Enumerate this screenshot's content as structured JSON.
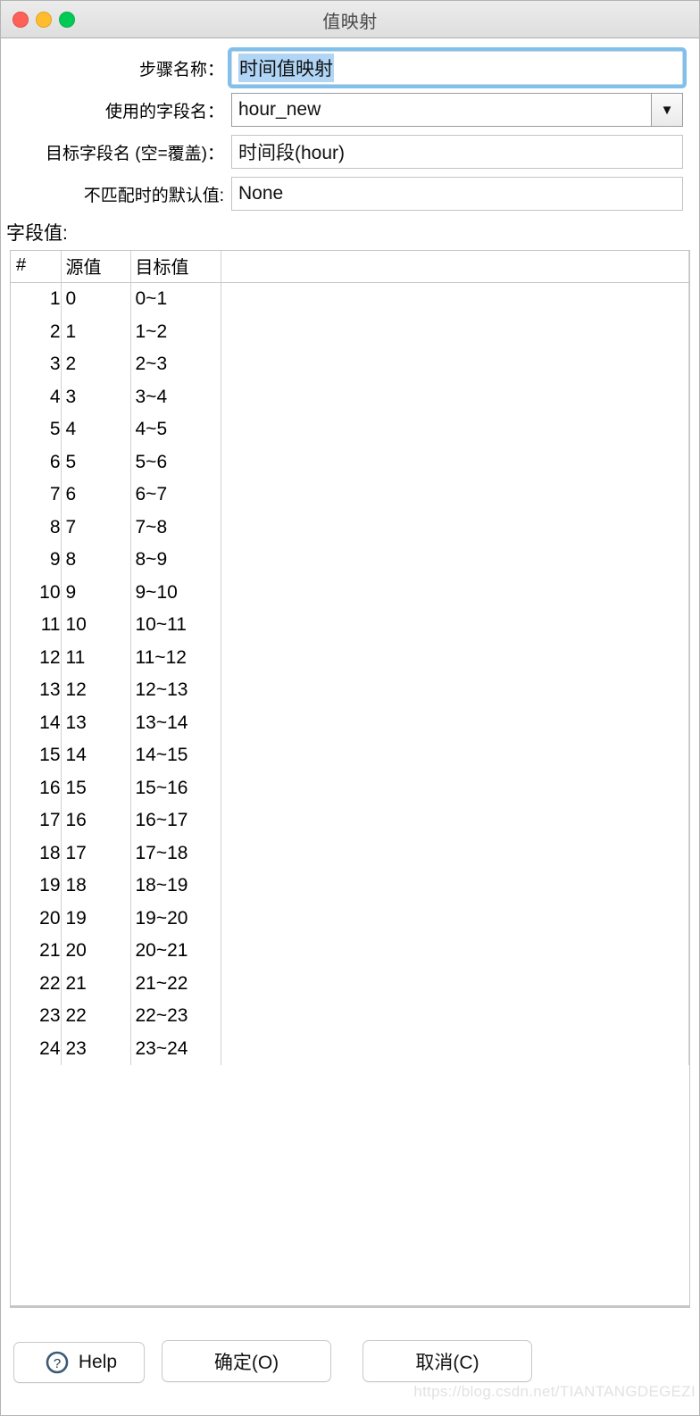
{
  "window": {
    "title": "值映射",
    "traffic_lights": [
      {
        "name": "close",
        "color": "#ff6159"
      },
      {
        "name": "minimize",
        "color": "#ffbd2e"
      },
      {
        "name": "maximize",
        "color": "#00ca56"
      }
    ]
  },
  "form": {
    "step_name": {
      "label": "步骤名称：",
      "value": "时间值映射",
      "selected": true
    },
    "source_field": {
      "label": "使用的字段名：",
      "value": "hour_new",
      "arrow": "▼"
    },
    "target_field": {
      "label": "目标字段名 (空=覆盖)：",
      "value": "时间段(hour)"
    },
    "default_value": {
      "label": "不匹配时的默认值:",
      "value": "None"
    }
  },
  "table": {
    "section_label": "字段值:",
    "columns": [
      "#",
      "源值",
      "目标值",
      ""
    ],
    "rows": [
      {
        "n": "1",
        "src": "0",
        "tgt": "0~1"
      },
      {
        "n": "2",
        "src": "1",
        "tgt": "1~2"
      },
      {
        "n": "3",
        "src": "2",
        "tgt": "2~3"
      },
      {
        "n": "4",
        "src": "3",
        "tgt": "3~4"
      },
      {
        "n": "5",
        "src": "4",
        "tgt": "4~5"
      },
      {
        "n": "6",
        "src": "5",
        "tgt": "5~6"
      },
      {
        "n": "7",
        "src": "6",
        "tgt": "6~7"
      },
      {
        "n": "8",
        "src": "7",
        "tgt": "7~8"
      },
      {
        "n": "9",
        "src": "8",
        "tgt": "8~9"
      },
      {
        "n": "10",
        "src": "9",
        "tgt": "9~10"
      },
      {
        "n": "11",
        "src": "10",
        "tgt": "10~11"
      },
      {
        "n": "12",
        "src": "11",
        "tgt": "11~12"
      },
      {
        "n": "13",
        "src": "12",
        "tgt": "12~13"
      },
      {
        "n": "14",
        "src": "13",
        "tgt": "13~14"
      },
      {
        "n": "15",
        "src": "14",
        "tgt": "14~15"
      },
      {
        "n": "16",
        "src": "15",
        "tgt": "15~16"
      },
      {
        "n": "17",
        "src": "16",
        "tgt": "16~17"
      },
      {
        "n": "18",
        "src": "17",
        "tgt": "17~18"
      },
      {
        "n": "19",
        "src": "18",
        "tgt": "18~19"
      },
      {
        "n": "20",
        "src": "19",
        "tgt": "19~20"
      },
      {
        "n": "21",
        "src": "20",
        "tgt": "20~21"
      },
      {
        "n": "22",
        "src": "21",
        "tgt": "21~22"
      },
      {
        "n": "23",
        "src": "22",
        "tgt": "22~23"
      },
      {
        "n": "24",
        "src": "23",
        "tgt": "23~24"
      }
    ]
  },
  "buttons": {
    "help": "Help",
    "ok": "确定(O)",
    "cancel": "取消(C)"
  },
  "watermark": "https://blog.csdn.net/TIANTANGDEGEZI",
  "colors": {
    "focus_ring": "#7ec0ee",
    "selection": "#b0d5f5",
    "title_text": "#4a4a4a",
    "grid_line": "#d2d2d2"
  }
}
